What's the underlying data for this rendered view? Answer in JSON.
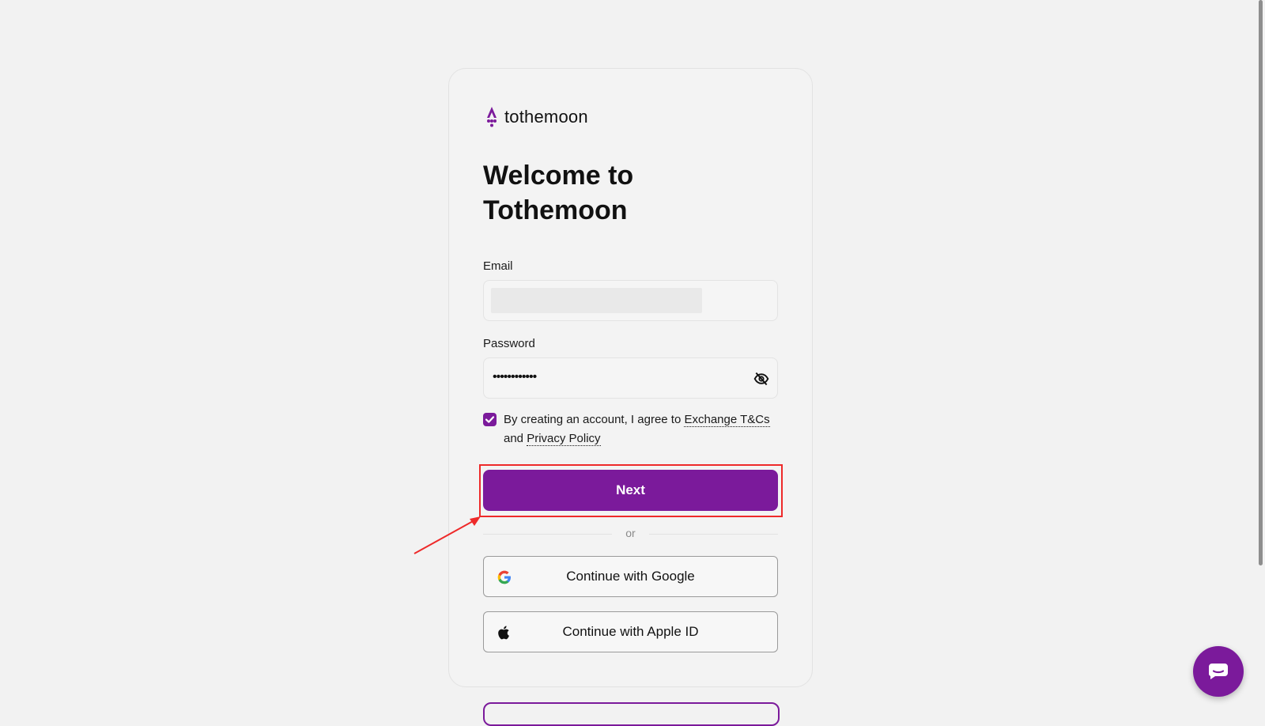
{
  "brand": {
    "name": "tothemoon",
    "primary_color": "#7b1a9b"
  },
  "heading": {
    "title": "Welcome to Tothemoon"
  },
  "form": {
    "email_label": "Email",
    "email_value": "",
    "password_label": "Password",
    "password_value": "••••••••••••",
    "consent": {
      "checked": true,
      "prefix": "By creating an account, I agree to ",
      "terms_link": "Exchange T&Cs",
      "middle": " and ",
      "privacy_link": "Privacy Policy"
    },
    "next_label": "Next",
    "divider_text": "or"
  },
  "social": {
    "google_label": "Continue with Google",
    "apple_label": "Continue with Apple ID"
  },
  "icons": {
    "logo": "tothemoon-logo-icon",
    "password_toggle": "eye-off-icon",
    "google": "google-icon",
    "apple": "apple-icon",
    "chat": "chat-icon"
  },
  "annotation": {
    "highlight_color": "#ee2a2a"
  }
}
